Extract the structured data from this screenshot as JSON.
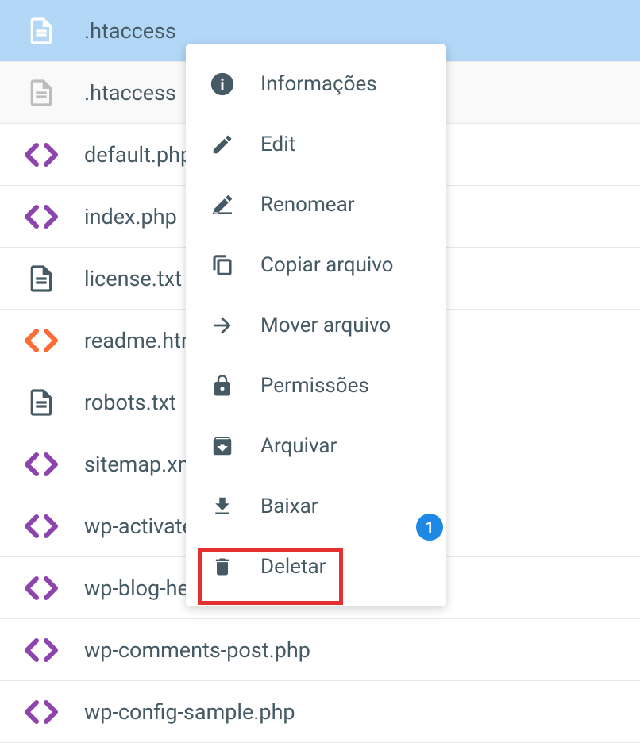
{
  "files": [
    {
      "name": ".htaccess",
      "icon": "file-white",
      "selected": true
    },
    {
      "name": ".htaccess",
      "icon": "file-gray",
      "alt": true
    },
    {
      "name": "default.php",
      "icon": "code-purple"
    },
    {
      "name": "index.php",
      "icon": "code-purple"
    },
    {
      "name": "license.txt",
      "icon": "file-dark"
    },
    {
      "name": "readme.html",
      "icon": "code-orange"
    },
    {
      "name": "robots.txt",
      "icon": "file-dark"
    },
    {
      "name": "sitemap.xml",
      "icon": "code-purple"
    },
    {
      "name": "wp-activate.php",
      "icon": "code-purple"
    },
    {
      "name": "wp-blog-header.php",
      "icon": "code-purple"
    },
    {
      "name": "wp-comments-post.php",
      "icon": "code-purple"
    },
    {
      "name": "wp-config-sample.php",
      "icon": "code-purple"
    }
  ],
  "menu": {
    "items": [
      {
        "id": "info",
        "label": "Informações",
        "icon": "info-icon"
      },
      {
        "id": "edit",
        "label": "Edit",
        "icon": "pencil-icon"
      },
      {
        "id": "rename",
        "label": "Renomear",
        "icon": "rename-icon"
      },
      {
        "id": "copy",
        "label": "Copiar arquivo",
        "icon": "copy-icon"
      },
      {
        "id": "move",
        "label": "Mover arquivo",
        "icon": "arrow-right-icon"
      },
      {
        "id": "permissions",
        "label": "Permissões",
        "icon": "lock-icon"
      },
      {
        "id": "archive",
        "label": "Arquivar",
        "icon": "archive-icon"
      },
      {
        "id": "download",
        "label": "Baixar",
        "icon": "download-icon"
      },
      {
        "id": "delete",
        "label": "Deletar",
        "icon": "trash-icon"
      }
    ]
  },
  "annotation": {
    "badge": "1"
  }
}
